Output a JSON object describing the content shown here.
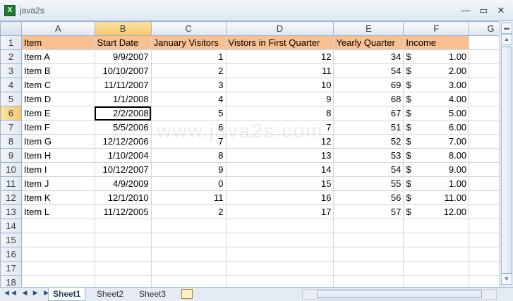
{
  "window": {
    "title": "java2s",
    "app_icon": "excel-icon"
  },
  "columns": [
    "A",
    "B",
    "C",
    "D",
    "E",
    "F",
    "G"
  ],
  "header_row": {
    "row_num": "1",
    "cells": [
      "Item",
      "Start Date",
      "January Visitors",
      "Vistors in First Quarter",
      "Yearly Quarter",
      "Income",
      ""
    ]
  },
  "rows": [
    {
      "row_num": "2",
      "item": "Item A",
      "start": "9/9/2007",
      "jan": "1",
      "q1": "12",
      "yearly": "34",
      "cur": "$",
      "income": "1.00"
    },
    {
      "row_num": "3",
      "item": "Item B",
      "start": "10/10/2007",
      "jan": "2",
      "q1": "11",
      "yearly": "54",
      "cur": "$",
      "income": "2.00"
    },
    {
      "row_num": "4",
      "item": "Item C",
      "start": "11/11/2007",
      "jan": "3",
      "q1": "10",
      "yearly": "69",
      "cur": "$",
      "income": "3.00"
    },
    {
      "row_num": "5",
      "item": "Item D",
      "start": "1/1/2008",
      "jan": "4",
      "q1": "9",
      "yearly": "68",
      "cur": "$",
      "income": "4.00"
    },
    {
      "row_num": "6",
      "item": "Item E",
      "start": "2/2/2008",
      "jan": "5",
      "q1": "8",
      "yearly": "67",
      "cur": "$",
      "income": "5.00"
    },
    {
      "row_num": "7",
      "item": "Item F",
      "start": "5/5/2006",
      "jan": "6",
      "q1": "7",
      "yearly": "51",
      "cur": "$",
      "income": "6.00"
    },
    {
      "row_num": "8",
      "item": "Item G",
      "start": "12/12/2006",
      "jan": "7",
      "q1": "12",
      "yearly": "52",
      "cur": "$",
      "income": "7.00"
    },
    {
      "row_num": "9",
      "item": "Item H",
      "start": "1/10/2004",
      "jan": "8",
      "q1": "13",
      "yearly": "53",
      "cur": "$",
      "income": "8.00"
    },
    {
      "row_num": "10",
      "item": "Item I",
      "start": "10/12/2007",
      "jan": "9",
      "q1": "14",
      "yearly": "54",
      "cur": "$",
      "income": "9.00"
    },
    {
      "row_num": "11",
      "item": "Item J",
      "start": "4/9/2009",
      "jan": "0",
      "q1": "15",
      "yearly": "55",
      "cur": "$",
      "income": "1.00"
    },
    {
      "row_num": "12",
      "item": "Item K",
      "start": "12/1/2010",
      "jan": "11",
      "q1": "16",
      "yearly": "56",
      "cur": "$",
      "income": "11.00"
    },
    {
      "row_num": "13",
      "item": "Item L",
      "start": "11/12/2005",
      "jan": "2",
      "q1": "17",
      "yearly": "57",
      "cur": "$",
      "income": "12.00"
    }
  ],
  "empty_rows": [
    "14",
    "15",
    "16",
    "17",
    "18"
  ],
  "selection": {
    "active_cell": "B6",
    "selected_column": "B",
    "selected_row": "6"
  },
  "watermark": "www.java2s.com",
  "sheet_tabs": [
    "Sheet1",
    "Sheet2",
    "Sheet3"
  ],
  "active_tab": "Sheet1",
  "colors": {
    "header_fill": "#fac090",
    "selected_header": "#f7c46a",
    "grid_line": "#d0d7e5"
  }
}
